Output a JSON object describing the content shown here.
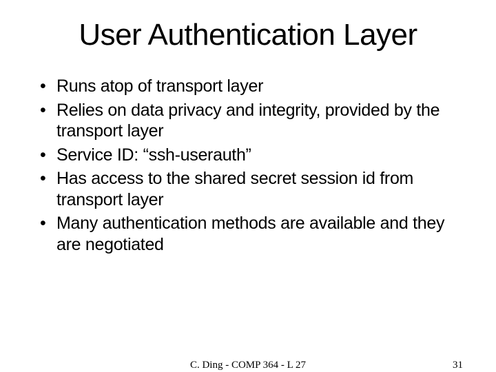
{
  "slide": {
    "title": "User Authentication Layer",
    "bullets": [
      "Runs atop of transport layer",
      "Relies on data privacy and integrity, provided by the transport layer",
      "Service ID: “ssh-userauth”",
      "Has access to the shared secret session id from transport layer",
      "Many authentication methods are available and they are negotiated"
    ],
    "footer_center": "C. Ding - COMP 364 - L 27",
    "slide_number": "31"
  }
}
